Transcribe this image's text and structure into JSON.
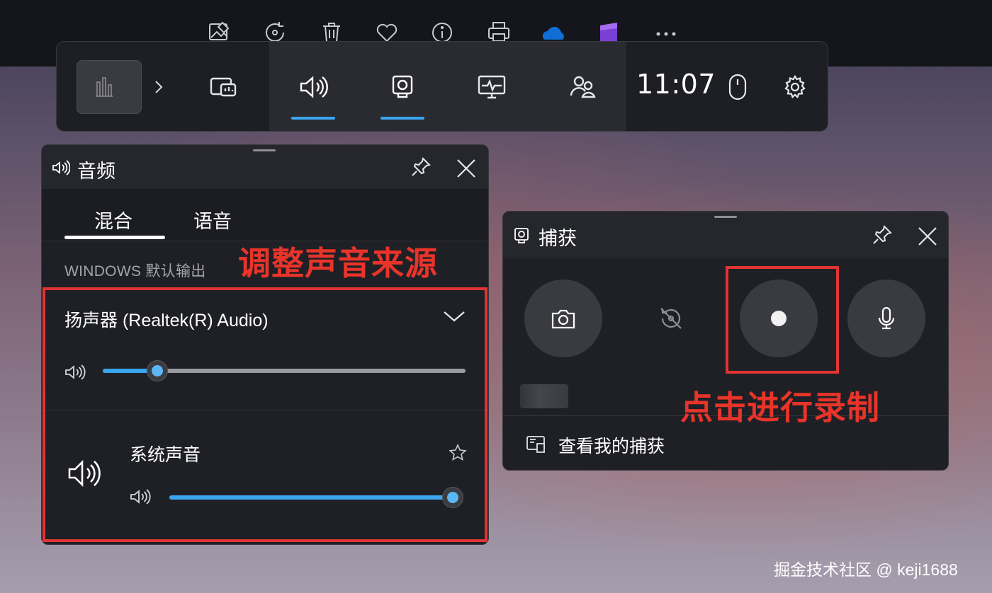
{
  "photo_toolbar": {
    "tools": [
      "edit-image-icon",
      "rotate-icon",
      "trash-icon",
      "heart-icon",
      "info-icon",
      "print-icon",
      "onedrive-icon",
      "clipchamp-icon",
      "more-icon"
    ]
  },
  "game_bar": {
    "widgets": [
      "performance-widget-icon",
      "audio-icon",
      "capture-icon",
      "resources-icon",
      "xbox-social-icon"
    ],
    "time": "11:07",
    "active_widgets": [
      "audio",
      "capture"
    ],
    "accent_color": "#3aa6f0"
  },
  "audio": {
    "title": "音频",
    "tabs": [
      "混合",
      "语音"
    ],
    "active_tab": "混合",
    "section_label": "WINDOWS 默认输出",
    "device": "扬声器 (Realtek(R) Audio)",
    "device_volume": 0.15,
    "apps": [
      {
        "name": "系统声音",
        "volume": 1.0
      }
    ]
  },
  "capture": {
    "title": "捕获",
    "buttons": [
      "screenshot-icon",
      "record-last-30s-icon",
      "record-icon",
      "microphone-icon"
    ],
    "link": "查看我的捕获"
  },
  "annotations": {
    "audio_note": "调整声音来源",
    "capture_note": "点击进行录制",
    "color": "#e23434"
  },
  "watermark": "掘金技术社区 @ keji1688"
}
